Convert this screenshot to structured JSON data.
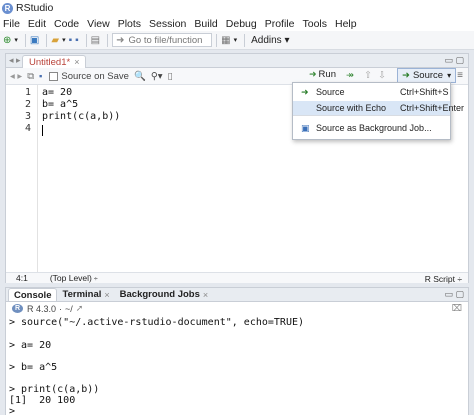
{
  "window": {
    "title": "RStudio",
    "app_icon": "R"
  },
  "menu": [
    "File",
    "Edit",
    "Code",
    "View",
    "Plots",
    "Session",
    "Build",
    "Debug",
    "Profile",
    "Tools",
    "Help"
  ],
  "main_toolbar": {
    "goto_placeholder": "Go to file/function",
    "addins_label": "Addins"
  },
  "editor": {
    "tab_label": "Untitled1*",
    "source_on_save_label": "Source on Save",
    "run_label": "Run",
    "source_label": "Source",
    "lines": [
      {
        "num": "1",
        "code": "a= 20"
      },
      {
        "num": "2",
        "code": "b= a^5"
      },
      {
        "num": "3",
        "code": "print(c(a,b))"
      },
      {
        "num": "4",
        "code": ""
      }
    ],
    "status": {
      "position": "4:1",
      "scope": "(Top Level)",
      "file_type": "R Script"
    }
  },
  "source_menu": {
    "items": [
      {
        "label": "Source",
        "shortcut": "Ctrl+Shift+S",
        "highlighted": false
      },
      {
        "label": "Source with Echo",
        "shortcut": "Ctrl+Shift+Enter",
        "highlighted": true
      },
      {
        "label": "Source as Background Job...",
        "shortcut": "",
        "highlighted": false
      }
    ]
  },
  "console": {
    "tabs": [
      {
        "label": "Console",
        "closable": false
      },
      {
        "label": "Terminal",
        "closable": true
      },
      {
        "label": "Background Jobs",
        "closable": true
      }
    ],
    "r_version": "R 4.3.0",
    "working_dir": "~/",
    "output": [
      "> source(\"~/.active-rstudio-document\", echo=TRUE)",
      "",
      "> a= 20",
      "",
      "> b= a^5",
      "",
      "> print(c(a,b))",
      "[1]  20 100",
      ">"
    ]
  },
  "colors": {
    "accent": "#6a8fd0",
    "highlight": "#d9e6f6",
    "modified_tab": "#b9433a"
  }
}
